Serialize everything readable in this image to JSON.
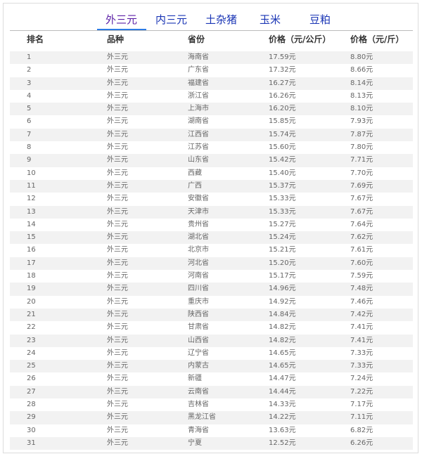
{
  "tabs": [
    {
      "label": "外三元",
      "active": true
    },
    {
      "label": "内三元",
      "active": false
    },
    {
      "label": "土杂猪",
      "active": false
    },
    {
      "label": "玉米",
      "active": false
    },
    {
      "label": "豆粕",
      "active": false
    }
  ],
  "table": {
    "headers": [
      "排名",
      "品种",
      "省份",
      "价格（元/公斤）",
      "价格（元/斤）"
    ],
    "rows": [
      [
        "1",
        "外三元",
        "海南省",
        "17.59元",
        "8.80元"
      ],
      [
        "2",
        "外三元",
        "广东省",
        "17.32元",
        "8.66元"
      ],
      [
        "3",
        "外三元",
        "福建省",
        "16.27元",
        "8.14元"
      ],
      [
        "4",
        "外三元",
        "浙江省",
        "16.26元",
        "8.13元"
      ],
      [
        "5",
        "外三元",
        "上海市",
        "16.20元",
        "8.10元"
      ],
      [
        "6",
        "外三元",
        "湖南省",
        "15.85元",
        "7.93元"
      ],
      [
        "7",
        "外三元",
        "江西省",
        "15.74元",
        "7.87元"
      ],
      [
        "8",
        "外三元",
        "江苏省",
        "15.60元",
        "7.80元"
      ],
      [
        "9",
        "外三元",
        "山东省",
        "15.42元",
        "7.71元"
      ],
      [
        "10",
        "外三元",
        "西藏",
        "15.40元",
        "7.70元"
      ],
      [
        "11",
        "外三元",
        "广西",
        "15.37元",
        "7.69元"
      ],
      [
        "12",
        "外三元",
        "安徽省",
        "15.33元",
        "7.67元"
      ],
      [
        "13",
        "外三元",
        "天津市",
        "15.33元",
        "7.67元"
      ],
      [
        "14",
        "外三元",
        "贵州省",
        "15.27元",
        "7.64元"
      ],
      [
        "15",
        "外三元",
        "湖北省",
        "15.24元",
        "7.62元"
      ],
      [
        "16",
        "外三元",
        "北京市",
        "15.21元",
        "7.61元"
      ],
      [
        "17",
        "外三元",
        "河北省",
        "15.20元",
        "7.60元"
      ],
      [
        "18",
        "外三元",
        "河南省",
        "15.17元",
        "7.59元"
      ],
      [
        "19",
        "外三元",
        "四川省",
        "14.96元",
        "7.48元"
      ],
      [
        "20",
        "外三元",
        "重庆市",
        "14.92元",
        "7.46元"
      ],
      [
        "21",
        "外三元",
        "陕西省",
        "14.84元",
        "7.42元"
      ],
      [
        "22",
        "外三元",
        "甘肃省",
        "14.82元",
        "7.41元"
      ],
      [
        "23",
        "外三元",
        "山西省",
        "14.82元",
        "7.41元"
      ],
      [
        "24",
        "外三元",
        "辽宁省",
        "14.65元",
        "7.33元"
      ],
      [
        "25",
        "外三元",
        "内蒙古",
        "14.65元",
        "7.33元"
      ],
      [
        "26",
        "外三元",
        "新疆",
        "14.47元",
        "7.24元"
      ],
      [
        "27",
        "外三元",
        "云南省",
        "14.44元",
        "7.22元"
      ],
      [
        "28",
        "外三元",
        "吉林省",
        "14.33元",
        "7.17元"
      ],
      [
        "29",
        "外三元",
        "黑龙江省",
        "14.22元",
        "7.11元"
      ],
      [
        "30",
        "外三元",
        "青海省",
        "13.63元",
        "6.82元"
      ],
      [
        "31",
        "外三元",
        "宁夏",
        "12.52元",
        "6.26元"
      ]
    ]
  },
  "colors": {
    "tab_text": "#1a35b5",
    "tab_active_text": "#5b1fa6",
    "tab_underline": "#2c7be5",
    "row_stripe": "#f2f2f2"
  }
}
